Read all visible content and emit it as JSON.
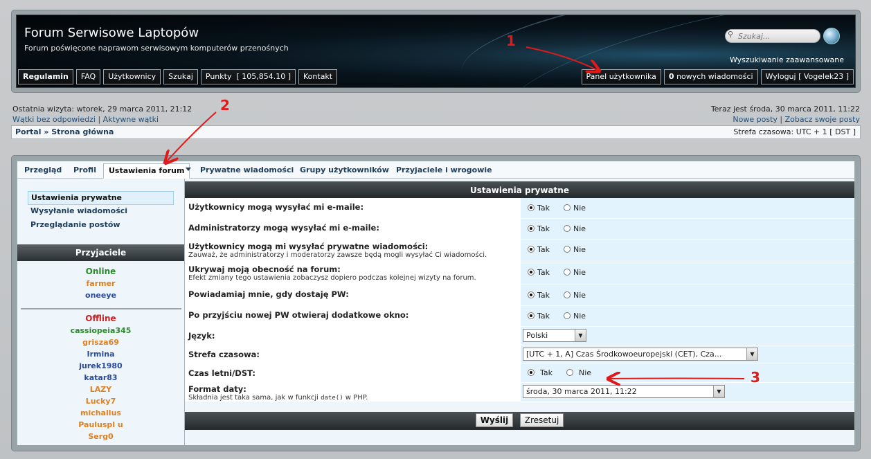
{
  "header": {
    "title": "Forum Serwisowe Laptopów",
    "description": "Forum poświęcone naprawom serwisowym komputerów przenośnych",
    "search_placeholder": "Szukaj...",
    "advanced_search": "Wyszukiwanie zaawansowane",
    "nav_left": [
      "Regulamin",
      "FAQ",
      "Użytkownicy",
      "Szukaj",
      "Punkty  [ 105,854.10 ]",
      "Kontakt"
    ],
    "nav_right": {
      "panel": "Panel użytkownika",
      "messages_count": "0",
      "messages_label": " nowych wiadomości",
      "logout": "Wyloguj [ Vogelek23 ]"
    }
  },
  "info": {
    "last_visit": "Ostatnia wizyta: wtorek, 29 marca 2011, 21:12",
    "unanswered": "Wątki bez odpowiedzi",
    "active": "Aktywne wątki",
    "now": "Teraz jest środa, 30 marca 2011, 11:22",
    "new_posts": "Nowe posty",
    "own_posts": "Zobacz swoje posty",
    "separator": "|"
  },
  "breadcrumb": {
    "path": "Portal » Strona główna",
    "timezone": "Strefa czasowa: UTC + 1 [ DST ]"
  },
  "tabs": [
    "Przegląd",
    "Profil",
    "Ustawienia forum",
    "Prywatne wiadomości",
    "Grupy użytkowników",
    "Przyjaciele i wrogowie"
  ],
  "sidebar": {
    "menu": [
      "Ustawienia prywatne",
      "Wysyłanie wiadomości",
      "Przeglądanie postów"
    ],
    "friends_title": "Przyjaciele",
    "online_label": "Online",
    "online": [
      "farmer",
      "oneeye"
    ],
    "offline_label": "Offline",
    "offline": [
      "cassiopeia345",
      "grisza69",
      "Irmina",
      "jurek1980",
      "katar83",
      "LAZY",
      "Lucky7",
      "michallus",
      "Pauluspl u",
      "Serg0"
    ]
  },
  "content": {
    "title": "Ustawienia prywatne",
    "yes": "Tak",
    "no": "Nie",
    "rows": [
      {
        "title": "Użytkownicy mogą wysyłać mi e-maile:",
        "note": ""
      },
      {
        "title": "Administratorzy mogą wysyłać mi e-maile:",
        "note": ""
      },
      {
        "title": "Użytkownicy mogą mi wysyłać prywatne wiadomości:",
        "note": "Zauważ, że administratorzy i moderatorzy zawsze będą mogli wysyłać Ci wiadomości."
      },
      {
        "title": "Ukrywaj moją obecność na forum:",
        "note": "Efekt zmiany tego ustawienia zobaczysz dopiero podczas kolejnej wizyty na forum."
      },
      {
        "title": "Powiadamiaj mnie, gdy dostaję PW:",
        "note": ""
      },
      {
        "title": "Po przyjściu nowej PW otwieraj dodatkowe okno:",
        "note": ""
      }
    ],
    "language_label": "Język:",
    "language_value": "Polski",
    "timezone_label": "Strefa czasowa:",
    "timezone_value": "[UTC + 1, A] Czas Środkowoeuropejski (CET), Cza...",
    "dst_label": "Czas letni/DST:",
    "date_label": "Format daty:",
    "date_note_a": "Składnia jest taka sama, jak w funkcji ",
    "date_note_code": "date()",
    "date_note_b": " w PHP.",
    "date_value": "środa, 30 marca 2011, 11:22",
    "submit": "Wyślij",
    "reset": "Zresetuj"
  },
  "annotations": [
    "1",
    "2",
    "3"
  ],
  "colors": {
    "accent": "#1f3d5c",
    "annotation": "#e01a1a",
    "online": "#2a8a2a",
    "offline": "#d12020"
  }
}
